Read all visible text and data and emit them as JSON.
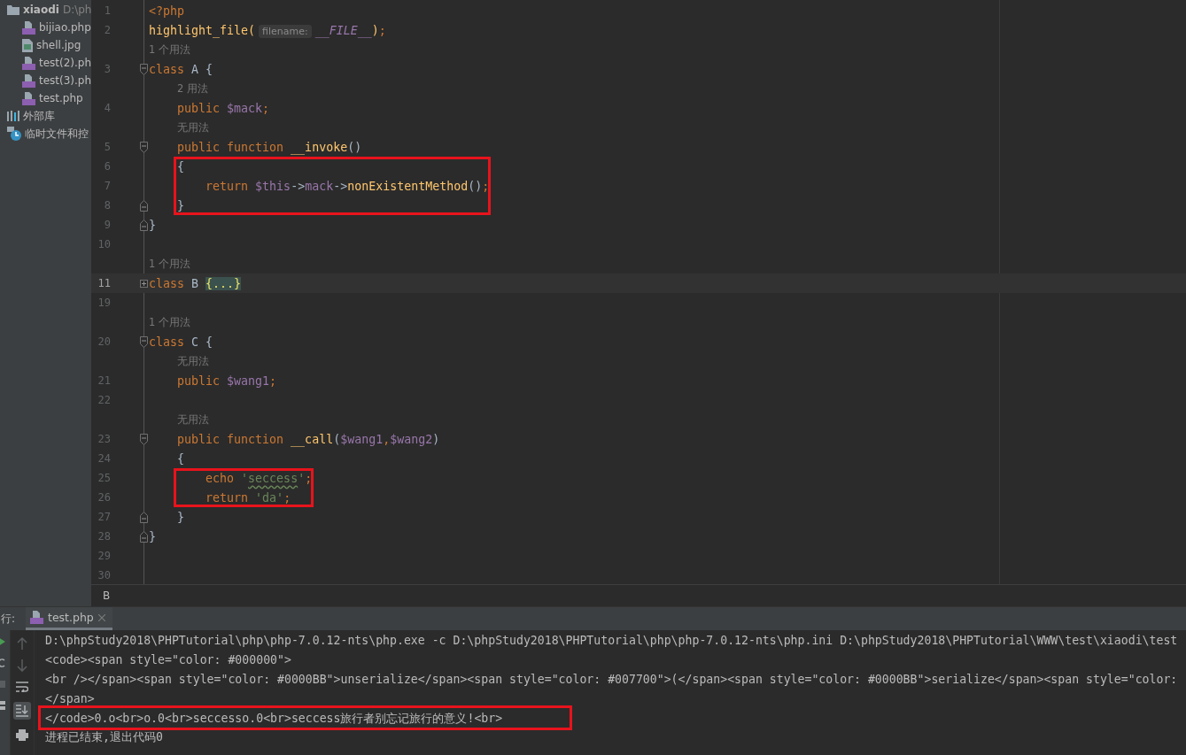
{
  "project_tree": {
    "root": {
      "name": "xiaodi",
      "path": "D:\\ph"
    },
    "files": [
      {
        "name": "bijiao.php",
        "kind": "php"
      },
      {
        "name": "shell.jpg",
        "kind": "image"
      },
      {
        "name": "test(2).ph",
        "kind": "php"
      },
      {
        "name": "test(3).ph",
        "kind": "php"
      },
      {
        "name": "test.php",
        "kind": "php"
      }
    ],
    "extra": [
      {
        "label": "外部库",
        "kind": "library"
      },
      {
        "label": "临时文件和控",
        "kind": "scratches"
      }
    ]
  },
  "editor": {
    "lines": [
      {
        "kind": "code",
        "n": "1",
        "current": false,
        "tokens": [
          {
            "t": "<?php",
            "kind": "kw"
          }
        ]
      },
      {
        "kind": "code",
        "n": "2",
        "current": false,
        "tokens": [
          {
            "t": "highlight_file(",
            "kind": "fn"
          },
          {
            "t": "filename:",
            "kind": "inlay"
          },
          {
            "t": "__FILE__",
            "kind": "const"
          },
          {
            "t": ")",
            "kind": "fn"
          },
          {
            "t": ";",
            "kind": "kw"
          }
        ]
      },
      {
        "kind": "usage",
        "text": "1 个用法"
      },
      {
        "kind": "code",
        "n": "3",
        "fold_marker": {
          "kind": "start"
        },
        "current": false,
        "tokens": [
          {
            "t": "class",
            "kind": "kw"
          },
          {
            "t": " A {",
            "kind": "plain"
          }
        ]
      },
      {
        "kind": "usage",
        "text": "2 用法"
      },
      {
        "kind": "code",
        "n": "4",
        "current": false,
        "tokens": [
          {
            "t": "    public ",
            "kind": "kw"
          },
          {
            "t": "$mack",
            "kind": "var"
          },
          {
            "t": ";",
            "kind": "kw"
          }
        ]
      },
      {
        "kind": "usage",
        "text": "无用法"
      },
      {
        "kind": "code",
        "n": "5",
        "fold_marker": {
          "kind": "start"
        },
        "current": false,
        "tokens": [
          {
            "t": "    public function ",
            "kind": "kw"
          },
          {
            "t": "__invoke",
            "kind": "fn"
          },
          {
            "t": "()",
            "kind": "plain"
          }
        ]
      },
      {
        "kind": "code",
        "n": "6",
        "current": false,
        "boxed": true,
        "tokens": [
          {
            "t": "    {",
            "kind": "plain"
          }
        ]
      },
      {
        "kind": "code",
        "n": "7",
        "current": false,
        "boxed": true,
        "tokens": [
          {
            "t": "        return ",
            "kind": "kw"
          },
          {
            "t": "$this",
            "kind": "var"
          },
          {
            "t": "->",
            "kind": "plain"
          },
          {
            "t": "mack",
            "kind": "var"
          },
          {
            "t": "->",
            "kind": "plain"
          },
          {
            "t": "nonExistentMethod",
            "kind": "fn"
          },
          {
            "t": "()",
            "kind": "plain"
          },
          {
            "t": ";",
            "kind": "kw"
          }
        ]
      },
      {
        "kind": "code",
        "n": "8",
        "fold_marker": {
          "kind": "end"
        },
        "current": false,
        "boxed": true,
        "tokens": [
          {
            "t": "    }",
            "kind": "plain"
          }
        ]
      },
      {
        "kind": "code",
        "n": "9",
        "fold_marker": {
          "kind": "end"
        },
        "current": false,
        "tokens": [
          {
            "t": "}",
            "kind": "plain"
          }
        ]
      },
      {
        "kind": "code",
        "n": "10",
        "current": false
      },
      {
        "kind": "usage",
        "text": "1 个用法"
      },
      {
        "kind": "code",
        "n": "11",
        "fold_marker": {
          "kind": "collapsed"
        },
        "current": true,
        "tokens": [
          {
            "t": "class",
            "kind": "kw"
          },
          {
            "t": " B ",
            "kind": "plain"
          },
          {
            "t": "{...}",
            "kind": "folded"
          }
        ]
      },
      {
        "kind": "code",
        "n": "19",
        "current": false
      },
      {
        "kind": "usage",
        "text": "1 个用法"
      },
      {
        "kind": "code",
        "n": "20",
        "fold_marker": {
          "kind": "start"
        },
        "current": false,
        "tokens": [
          {
            "t": "class",
            "kind": "kw"
          },
          {
            "t": " C {",
            "kind": "plain"
          }
        ]
      },
      {
        "kind": "usage",
        "text": "无用法"
      },
      {
        "kind": "code",
        "n": "21",
        "current": false,
        "tokens": [
          {
            "t": "    public ",
            "kind": "kw"
          },
          {
            "t": "$wang1",
            "kind": "var"
          },
          {
            "t": ";",
            "kind": "kw"
          }
        ]
      },
      {
        "kind": "code",
        "n": "22",
        "current": false
      },
      {
        "kind": "usage",
        "text": "无用法"
      },
      {
        "kind": "code",
        "n": "23",
        "fold_marker": {
          "kind": "start"
        },
        "current": false,
        "tokens": [
          {
            "t": "    public function ",
            "kind": "kw"
          },
          {
            "t": "__call",
            "kind": "fn"
          },
          {
            "t": "(",
            "kind": "plain"
          },
          {
            "t": "$wang1",
            "kind": "var"
          },
          {
            "t": ",",
            "kind": "kw"
          },
          {
            "t": "$wang2",
            "kind": "var"
          },
          {
            "t": ")",
            "kind": "plain"
          }
        ]
      },
      {
        "kind": "code",
        "n": "24",
        "current": false,
        "tokens": [
          {
            "t": "    {",
            "kind": "plain"
          }
        ]
      },
      {
        "kind": "code",
        "n": "25",
        "current": false,
        "boxed": true,
        "tokens": [
          {
            "t": "        echo ",
            "kind": "kw"
          },
          {
            "t": "'",
            "kind": "str"
          },
          {
            "t": "seccess",
            "kind": "str_typo"
          },
          {
            "t": "'",
            "kind": "str"
          },
          {
            "t": ";",
            "kind": "kw"
          }
        ]
      },
      {
        "kind": "code",
        "n": "26",
        "current": false,
        "boxed": true,
        "tokens": [
          {
            "t": "        return ",
            "kind": "kw"
          },
          {
            "t": "'da'",
            "kind": "str"
          },
          {
            "t": ";",
            "kind": "kw"
          }
        ]
      },
      {
        "kind": "code",
        "n": "27",
        "fold_marker": {
          "kind": "end"
        },
        "current": false,
        "tokens": [
          {
            "t": "    }",
            "kind": "plain"
          }
        ]
      },
      {
        "kind": "code",
        "n": "28",
        "fold_marker": {
          "kind": "end"
        },
        "current": false,
        "tokens": [
          {
            "t": "}",
            "kind": "plain"
          }
        ]
      },
      {
        "kind": "code",
        "n": "29",
        "current": false
      },
      {
        "kind": "code",
        "n": "30",
        "current": false
      }
    ],
    "breadcrumb": "B"
  },
  "run_panel": {
    "title": "行:",
    "tabs": [
      {
        "label": "test.php",
        "selected": true
      }
    ],
    "output": [
      {
        "text": "D:\\phpStudy2018\\PHPTutorial\\php\\php-7.0.12-nts\\php.exe -c D:\\phpStudy2018\\PHPTutorial\\php\\php-7.0.12-nts\\php.ini D:\\phpStudy2018\\PHPTutorial\\WWW\\test\\xiaodi\\test"
      },
      {
        "text": "<code><span style=\"color: #000000\">"
      },
      {
        "text": "<br /></span><span style=\"color: #0000BB\">unserialize</span><span style=\"color: #007700\">(</span><span style=\"color: #0000BB\">serialize</span><span style=\"color:"
      },
      {
        "text": "</span>"
      },
      {
        "text": "</code>0.o<br>o.0<br>seccesso.0<br>seccess旅行者别忘记旅行的意义!<br>",
        "boxed": true
      },
      {
        "text": "进程已结束,退出代码0"
      }
    ]
  }
}
